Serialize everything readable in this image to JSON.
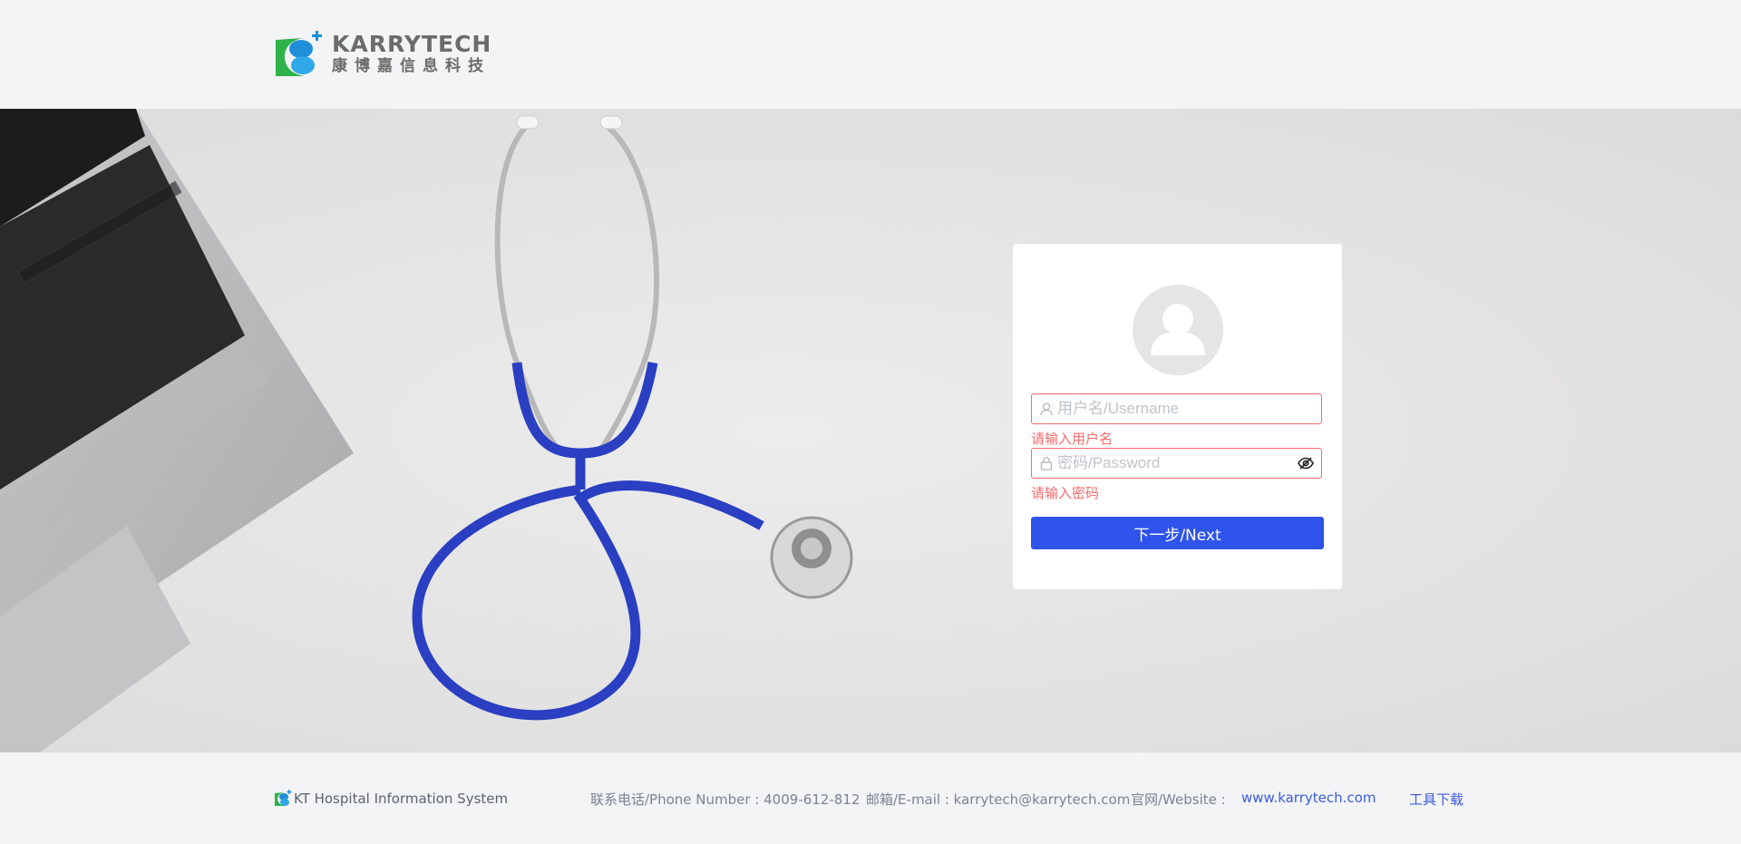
{
  "header": {
    "logo_en": "KARRYTECH",
    "logo_cn": "康博嘉信息科技"
  },
  "login": {
    "username_placeholder": "用户名/Username",
    "username_error": "请输入用户名",
    "password_placeholder": "密码/Password",
    "password_error": "请输入密码",
    "next_label": "下一步/Next"
  },
  "footer": {
    "system_name": "KT Hospital Information System",
    "phone": "联系电话/Phone Number : 4009-612-812",
    "email": "邮箱/E-mail : karrytech@karrytech.com",
    "website_label": "官网/Website :",
    "website_link": "www.karrytech.com",
    "tools_link": "工具下载"
  },
  "colors": {
    "primary_button": "#2f54eb",
    "error": "#f56c6c",
    "link": "#3b5bdb",
    "logo_green": "#2fb24a",
    "logo_blue": "#1e8fd8"
  },
  "icons": [
    "user-icon",
    "lock-icon",
    "eye-hidden-icon",
    "avatar-icon",
    "karrytech-logo-icon"
  ]
}
